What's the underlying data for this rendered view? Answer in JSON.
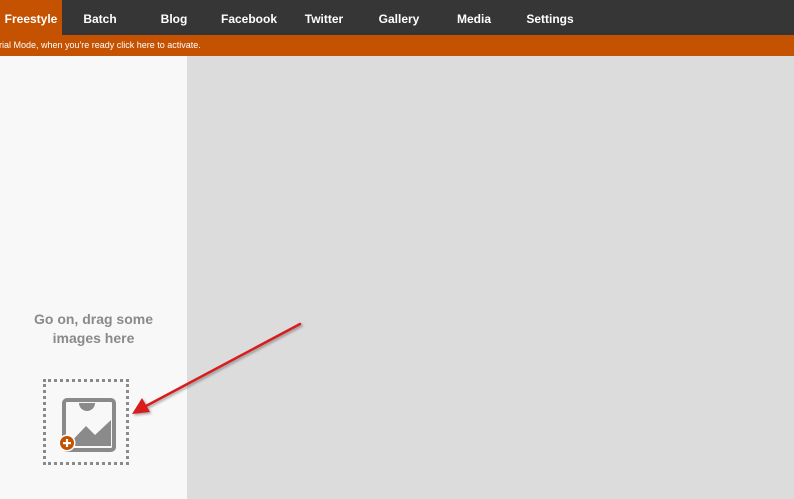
{
  "nav": {
    "items": [
      {
        "label": "Freestyle",
        "icon": "grid-icon",
        "active": true
      },
      {
        "label": "Batch",
        "icon": "batch-icon"
      },
      {
        "label": "Blog",
        "icon": "blog-icon"
      },
      {
        "label": "Facebook",
        "icon": "facebook-icon"
      },
      {
        "label": "Twitter",
        "icon": "twitter-icon"
      },
      {
        "label": "Gallery",
        "icon": "gallery-icon"
      },
      {
        "label": "Media",
        "icon": "media-icon"
      },
      {
        "label": "Settings",
        "icon": "gear-icon"
      }
    ]
  },
  "banner": {
    "text": "rial Mode, when you're ready click here to activate."
  },
  "left_panel": {
    "drop_hint": {
      "line1": "Go on, drag some",
      "line2": "images here"
    },
    "drop_zone_icon": "add-image-icon"
  },
  "colors": {
    "nav_bg": "#363636",
    "accent": "#c45200",
    "panel_bg": "#f8f8f8",
    "canvas_bg": "#dcdcdc",
    "arrow": "#d81c1c"
  }
}
